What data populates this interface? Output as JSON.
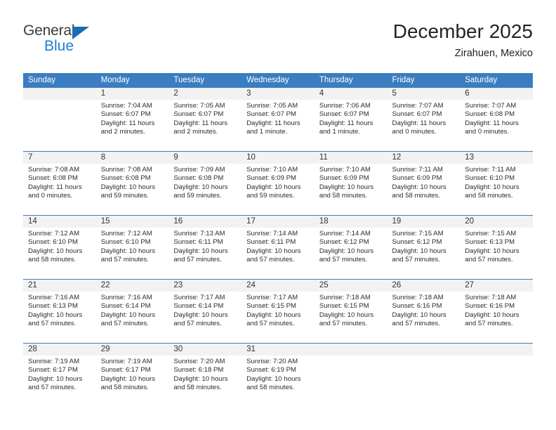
{
  "brand": {
    "line1": "General",
    "line2": "Blue",
    "triangle_icon": "triangle-icon",
    "color_dark": "#3b3b3b",
    "color_blue": "#1b7fd4"
  },
  "header": {
    "title": "December 2025",
    "subtitle": "Zirahuen, Mexico"
  },
  "theme": {
    "header_blue": "#3a7dc0",
    "daynum_band": "#f2f2f2",
    "text": "#2b2b2b"
  },
  "calendar": {
    "weekday_headers": [
      "Sunday",
      "Monday",
      "Tuesday",
      "Wednesday",
      "Thursday",
      "Friday",
      "Saturday"
    ],
    "weeks": [
      [
        {
          "day": "",
          "sunrise": "",
          "sunset": "",
          "daylight1": "",
          "daylight2": ""
        },
        {
          "day": "1",
          "sunrise": "Sunrise: 7:04 AM",
          "sunset": "Sunset: 6:07 PM",
          "daylight1": "Daylight: 11 hours",
          "daylight2": "and 2 minutes."
        },
        {
          "day": "2",
          "sunrise": "Sunrise: 7:05 AM",
          "sunset": "Sunset: 6:07 PM",
          "daylight1": "Daylight: 11 hours",
          "daylight2": "and 2 minutes."
        },
        {
          "day": "3",
          "sunrise": "Sunrise: 7:05 AM",
          "sunset": "Sunset: 6:07 PM",
          "daylight1": "Daylight: 11 hours",
          "daylight2": "and 1 minute."
        },
        {
          "day": "4",
          "sunrise": "Sunrise: 7:06 AM",
          "sunset": "Sunset: 6:07 PM",
          "daylight1": "Daylight: 11 hours",
          "daylight2": "and 1 minute."
        },
        {
          "day": "5",
          "sunrise": "Sunrise: 7:07 AM",
          "sunset": "Sunset: 6:07 PM",
          "daylight1": "Daylight: 11 hours",
          "daylight2": "and 0 minutes."
        },
        {
          "day": "6",
          "sunrise": "Sunrise: 7:07 AM",
          "sunset": "Sunset: 6:08 PM",
          "daylight1": "Daylight: 11 hours",
          "daylight2": "and 0 minutes."
        }
      ],
      [
        {
          "day": "7",
          "sunrise": "Sunrise: 7:08 AM",
          "sunset": "Sunset: 6:08 PM",
          "daylight1": "Daylight: 11 hours",
          "daylight2": "and 0 minutes."
        },
        {
          "day": "8",
          "sunrise": "Sunrise: 7:08 AM",
          "sunset": "Sunset: 6:08 PM",
          "daylight1": "Daylight: 10 hours",
          "daylight2": "and 59 minutes."
        },
        {
          "day": "9",
          "sunrise": "Sunrise: 7:09 AM",
          "sunset": "Sunset: 6:08 PM",
          "daylight1": "Daylight: 10 hours",
          "daylight2": "and 59 minutes."
        },
        {
          "day": "10",
          "sunrise": "Sunrise: 7:10 AM",
          "sunset": "Sunset: 6:09 PM",
          "daylight1": "Daylight: 10 hours",
          "daylight2": "and 59 minutes."
        },
        {
          "day": "11",
          "sunrise": "Sunrise: 7:10 AM",
          "sunset": "Sunset: 6:09 PM",
          "daylight1": "Daylight: 10 hours",
          "daylight2": "and 58 minutes."
        },
        {
          "day": "12",
          "sunrise": "Sunrise: 7:11 AM",
          "sunset": "Sunset: 6:09 PM",
          "daylight1": "Daylight: 10 hours",
          "daylight2": "and 58 minutes."
        },
        {
          "day": "13",
          "sunrise": "Sunrise: 7:11 AM",
          "sunset": "Sunset: 6:10 PM",
          "daylight1": "Daylight: 10 hours",
          "daylight2": "and 58 minutes."
        }
      ],
      [
        {
          "day": "14",
          "sunrise": "Sunrise: 7:12 AM",
          "sunset": "Sunset: 6:10 PM",
          "daylight1": "Daylight: 10 hours",
          "daylight2": "and 58 minutes."
        },
        {
          "day": "15",
          "sunrise": "Sunrise: 7:12 AM",
          "sunset": "Sunset: 6:10 PM",
          "daylight1": "Daylight: 10 hours",
          "daylight2": "and 57 minutes."
        },
        {
          "day": "16",
          "sunrise": "Sunrise: 7:13 AM",
          "sunset": "Sunset: 6:11 PM",
          "daylight1": "Daylight: 10 hours",
          "daylight2": "and 57 minutes."
        },
        {
          "day": "17",
          "sunrise": "Sunrise: 7:14 AM",
          "sunset": "Sunset: 6:11 PM",
          "daylight1": "Daylight: 10 hours",
          "daylight2": "and 57 minutes."
        },
        {
          "day": "18",
          "sunrise": "Sunrise: 7:14 AM",
          "sunset": "Sunset: 6:12 PM",
          "daylight1": "Daylight: 10 hours",
          "daylight2": "and 57 minutes."
        },
        {
          "day": "19",
          "sunrise": "Sunrise: 7:15 AM",
          "sunset": "Sunset: 6:12 PM",
          "daylight1": "Daylight: 10 hours",
          "daylight2": "and 57 minutes."
        },
        {
          "day": "20",
          "sunrise": "Sunrise: 7:15 AM",
          "sunset": "Sunset: 6:13 PM",
          "daylight1": "Daylight: 10 hours",
          "daylight2": "and 57 minutes."
        }
      ],
      [
        {
          "day": "21",
          "sunrise": "Sunrise: 7:16 AM",
          "sunset": "Sunset: 6:13 PM",
          "daylight1": "Daylight: 10 hours",
          "daylight2": "and 57 minutes."
        },
        {
          "day": "22",
          "sunrise": "Sunrise: 7:16 AM",
          "sunset": "Sunset: 6:14 PM",
          "daylight1": "Daylight: 10 hours",
          "daylight2": "and 57 minutes."
        },
        {
          "day": "23",
          "sunrise": "Sunrise: 7:17 AM",
          "sunset": "Sunset: 6:14 PM",
          "daylight1": "Daylight: 10 hours",
          "daylight2": "and 57 minutes."
        },
        {
          "day": "24",
          "sunrise": "Sunrise: 7:17 AM",
          "sunset": "Sunset: 6:15 PM",
          "daylight1": "Daylight: 10 hours",
          "daylight2": "and 57 minutes."
        },
        {
          "day": "25",
          "sunrise": "Sunrise: 7:18 AM",
          "sunset": "Sunset: 6:15 PM",
          "daylight1": "Daylight: 10 hours",
          "daylight2": "and 57 minutes."
        },
        {
          "day": "26",
          "sunrise": "Sunrise: 7:18 AM",
          "sunset": "Sunset: 6:16 PM",
          "daylight1": "Daylight: 10 hours",
          "daylight2": "and 57 minutes."
        },
        {
          "day": "27",
          "sunrise": "Sunrise: 7:18 AM",
          "sunset": "Sunset: 6:16 PM",
          "daylight1": "Daylight: 10 hours",
          "daylight2": "and 57 minutes."
        }
      ],
      [
        {
          "day": "28",
          "sunrise": "Sunrise: 7:19 AM",
          "sunset": "Sunset: 6:17 PM",
          "daylight1": "Daylight: 10 hours",
          "daylight2": "and 57 minutes."
        },
        {
          "day": "29",
          "sunrise": "Sunrise: 7:19 AM",
          "sunset": "Sunset: 6:17 PM",
          "daylight1": "Daylight: 10 hours",
          "daylight2": "and 58 minutes."
        },
        {
          "day": "30",
          "sunrise": "Sunrise: 7:20 AM",
          "sunset": "Sunset: 6:18 PM",
          "daylight1": "Daylight: 10 hours",
          "daylight2": "and 58 minutes."
        },
        {
          "day": "31",
          "sunrise": "Sunrise: 7:20 AM",
          "sunset": "Sunset: 6:19 PM",
          "daylight1": "Daylight: 10 hours",
          "daylight2": "and 58 minutes."
        },
        {
          "day": "",
          "sunrise": "",
          "sunset": "",
          "daylight1": "",
          "daylight2": ""
        },
        {
          "day": "",
          "sunrise": "",
          "sunset": "",
          "daylight1": "",
          "daylight2": ""
        },
        {
          "day": "",
          "sunrise": "",
          "sunset": "",
          "daylight1": "",
          "daylight2": ""
        }
      ]
    ]
  }
}
